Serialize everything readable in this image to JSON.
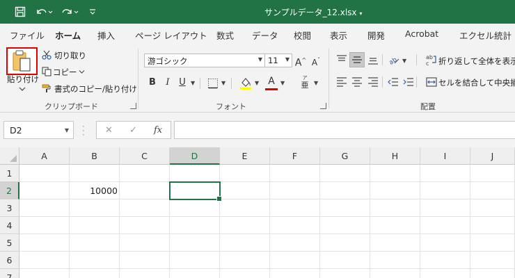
{
  "titlebar": {
    "title": "サンプルデータ_12.xlsx",
    "title_caret": "▾",
    "bg_color": "#217346"
  },
  "tabs": [
    "ファイル",
    "ホーム",
    "挿入",
    "ページ レイアウト",
    "数式",
    "データ",
    "校閲",
    "表示",
    "開発",
    "Acrobat",
    "エクセル統計"
  ],
  "active_tab": "ホーム",
  "clipboard": {
    "paste_label": "貼り付け",
    "cut_label": "切り取り",
    "copy_label": "コピー",
    "format_painter_label": "書式のコピー/貼り付け",
    "group_label": "クリップボード"
  },
  "font": {
    "font_name": "游ゴシック",
    "font_size": "11",
    "group_label": "フォント",
    "bold": "B",
    "italic": "I",
    "underline": "U",
    "grow": "A",
    "shrink": "A",
    "font_color_letter": "A",
    "phonetic": "亜",
    "phonetic_top": "ア",
    "highlight_color": "#ffff00",
    "font_color": "#e00000"
  },
  "alignment": {
    "wrap_label": "折り返して全体を表示す",
    "merge_label": "セルを結合して中央揃え",
    "group_label": "配置"
  },
  "formula_bar": {
    "name_box": "D2",
    "cancel": "✕",
    "enter": "✓",
    "fx": "fx",
    "value": ""
  },
  "sheet": {
    "columns": [
      "A",
      "B",
      "C",
      "D",
      "E",
      "F",
      "G",
      "H",
      "I",
      "J"
    ],
    "rows": [
      "1",
      "2",
      "3",
      "4",
      "5",
      "6",
      "7"
    ],
    "active_cell": "D2",
    "cells": {
      "B2": "10000"
    }
  },
  "icons": {
    "save": "save-icon",
    "undo": "undo-icon",
    "redo": "redo-icon",
    "customize": "customize-qat-icon"
  }
}
